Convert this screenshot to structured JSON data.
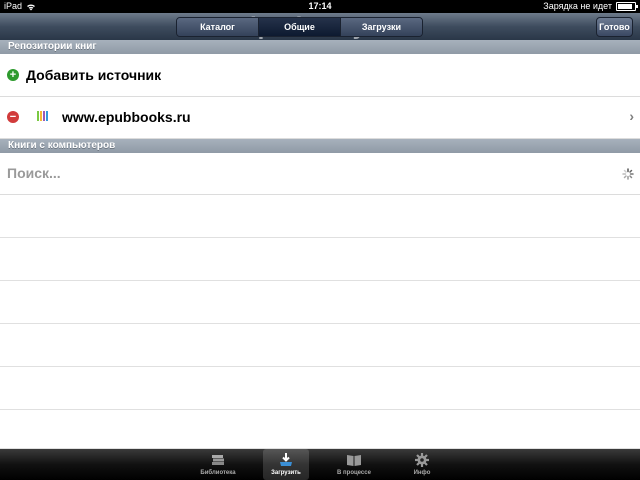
{
  "status": {
    "device": "iPad",
    "time": "17:14",
    "charging": "Зарядка не идет",
    "battery_fraction": 0.9
  },
  "watermark": "ipadstory.ru",
  "nav": {
    "segments": [
      {
        "label": "Каталог",
        "selected": false
      },
      {
        "label": "Общие",
        "selected": true
      },
      {
        "label": "Загрузки",
        "selected": false
      }
    ],
    "done_label": "Готово"
  },
  "sections": {
    "repos": "Репозитории книг",
    "computers": "Книги с компьютеров"
  },
  "repos": {
    "add_label": "Добавить источник",
    "items": [
      {
        "label": "www.epubbooks.ru"
      }
    ]
  },
  "search": {
    "placeholder": "Поиск..."
  },
  "tabbar": {
    "items": [
      {
        "label": "Библиотека",
        "icon": "books-stack-icon",
        "selected": false
      },
      {
        "label": "Загрузить",
        "icon": "download-tray-icon",
        "selected": true
      },
      {
        "label": "В процессе",
        "icon": "open-book-icon",
        "selected": false
      },
      {
        "label": "Инфо",
        "icon": "gear-icon",
        "selected": false
      }
    ]
  },
  "colors": {
    "add": "#2e9a2e",
    "remove": "#d13b3b",
    "nav": "#3e4c5e"
  }
}
